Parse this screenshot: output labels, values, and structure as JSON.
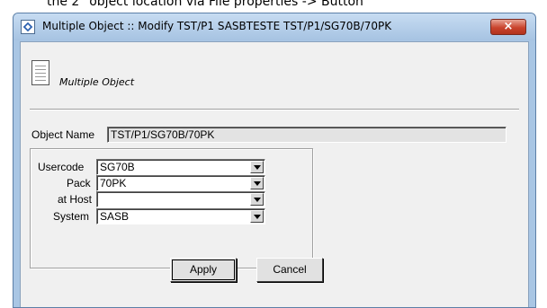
{
  "background": {
    "text": "the 2\" object location via File properties -> Button"
  },
  "window": {
    "title": "Multiple Object :: Modify TST/P1 SASBTESTE TST/P1/SG70B/70PK",
    "close_label": "×"
  },
  "header": {
    "object_type": "Multiple Object"
  },
  "object_name": {
    "label": "Object Name",
    "value": "TST/P1/SG70B/70PK"
  },
  "fields": {
    "usercode": {
      "label": "Usercode",
      "value": "SG70B"
    },
    "pack": {
      "label": "Pack",
      "value": "70PK"
    },
    "host": {
      "label": "at Host",
      "value": ""
    },
    "system": {
      "label": "System",
      "value": "SASB"
    }
  },
  "buttons": {
    "apply": "Apply",
    "cancel": "Cancel"
  }
}
